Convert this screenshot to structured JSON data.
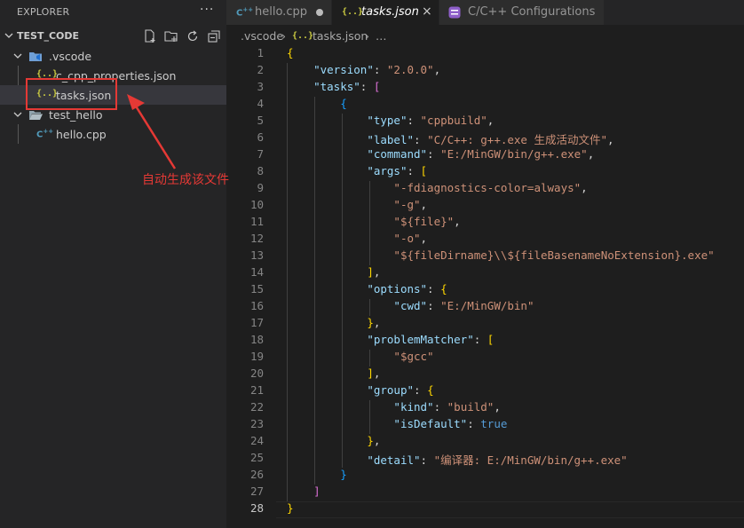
{
  "sidebar": {
    "title": "EXPLORER",
    "more": "···",
    "section_title": "TEST_CODE",
    "tree": [
      {
        "label": ".vscode",
        "kind": "folder"
      },
      {
        "label": "c_cpp_properties.json",
        "kind": "json"
      },
      {
        "label": "tasks.json",
        "kind": "json",
        "selected": true
      },
      {
        "label": "test_hello",
        "kind": "folder"
      },
      {
        "label": "hello.cpp",
        "kind": "cpp"
      }
    ]
  },
  "annotation": {
    "text": "自动生成该文件",
    "color": "#e53935"
  },
  "tabs": [
    {
      "label": "hello.cpp",
      "icon": "cpp-icon",
      "modified": true
    },
    {
      "label": "tasks.json",
      "icon": "json-braces-icon",
      "active": true,
      "close": "×"
    },
    {
      "label": "C/C++ Configurations",
      "icon": "settings-editor-icon"
    }
  ],
  "breadcrumb": {
    "folder": ".vscode",
    "sep": "›",
    "file": "tasks.json",
    "more": "…"
  },
  "editor": {
    "line_numbers": [
      "1",
      "2",
      "3",
      "4",
      "5",
      "6",
      "7",
      "8",
      "9",
      "10",
      "11",
      "12",
      "13",
      "14",
      "15",
      "16",
      "17",
      "18",
      "19",
      "20",
      "21",
      "22",
      "23",
      "24",
      "25",
      "26",
      "27",
      "28"
    ],
    "current_line": "28",
    "code": {
      "l1_open": "{",
      "version_key": "\"version\"",
      "version_val": "\"2.0.0\"",
      "tasks_key": "\"tasks\"",
      "tasks_open": "[",
      "task_open": "{",
      "type_key": "\"type\"",
      "type_val": "\"cppbuild\"",
      "label_key": "\"label\"",
      "label_val": "\"C/C++: g++.exe 生成活动文件\"",
      "command_key": "\"command\"",
      "command_val": "\"E:/MinGW/bin/g++.exe\"",
      "args_key": "\"args\"",
      "args_open": "[",
      "arg1": "\"-fdiagnostics-color=always\"",
      "arg2": "\"-g\"",
      "arg3": "\"${file}\"",
      "arg4": "\"-o\"",
      "arg5": "\"${fileDirname}\\\\${fileBasenameNoExtension}.exe\"",
      "args_close": "]",
      "options_key": "\"options\"",
      "options_open": "{",
      "cwd_key": "\"cwd\"",
      "cwd_val": "\"E:/MinGW/bin\"",
      "options_close": "}",
      "pm_key": "\"problemMatcher\"",
      "pm_open": "[",
      "pm_val": "\"$gcc\"",
      "pm_close": "]",
      "group_key": "\"group\"",
      "group_open": "{",
      "kind_key": "\"kind\"",
      "kind_val": "\"build\"",
      "isdefault_key": "\"isDefault\"",
      "isdefault_val": "true",
      "group_close": "}",
      "detail_key": "\"detail\"",
      "detail_val": "\"编译器: E:/MinGW/bin/g++.exe\"",
      "task_close": "}",
      "tasks_close": "]",
      "l28_close": "}"
    }
  },
  "colors": {
    "background": "#1e1e1e",
    "sidebar": "#252526",
    "json_key": "#9cdcfe",
    "json_string": "#ce9178",
    "annotation_red": "#e53935"
  }
}
